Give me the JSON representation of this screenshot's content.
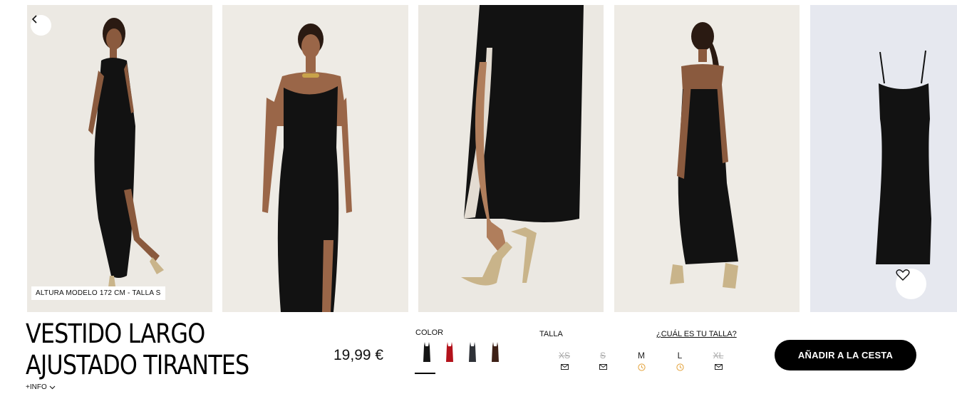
{
  "product": {
    "title_line1": "VESTIDO LARGO",
    "title_line2": "AJUSTADO TIRANTES",
    "info_label": "+INFO",
    "price": "19,99 €"
  },
  "gallery": {
    "model_tag": "ALTURA MODELO 172 CM - TALLA S",
    "images": [
      "model-front-side",
      "model-front",
      "leg-detail-heels",
      "model-back",
      "dress-flat"
    ]
  },
  "color": {
    "label": "COLOR",
    "swatches": [
      {
        "name": "black",
        "hex": "#151515",
        "selected": true
      },
      {
        "name": "red",
        "hex": "#b3121b",
        "selected": false
      },
      {
        "name": "charcoal",
        "hex": "#2f3238",
        "selected": false
      },
      {
        "name": "brown",
        "hex": "#3e2016",
        "selected": false
      }
    ]
  },
  "size": {
    "label": "TALLA",
    "guide_link": "¿CUÁL ES TU TALLA?",
    "options": [
      {
        "label": "XS",
        "available": false,
        "icon": "mail-icon"
      },
      {
        "label": "S",
        "available": false,
        "icon": "mail-icon"
      },
      {
        "label": "M",
        "available": true,
        "icon": "clock-icon"
      },
      {
        "label": "L",
        "available": true,
        "icon": "clock-icon"
      },
      {
        "label": "XL",
        "available": false,
        "icon": "mail-icon"
      }
    ]
  },
  "cart": {
    "add_label": "AÑADIR A LA CESTA"
  },
  "colors": {
    "accent": "#000000",
    "clock": "#e3a23a"
  }
}
